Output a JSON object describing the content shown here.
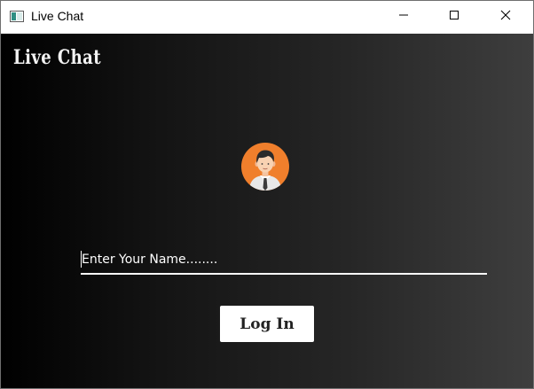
{
  "window": {
    "title": "Live Chat",
    "controls": {
      "minimize": "minimize-icon",
      "maximize": "maximize-icon",
      "close": "close-icon"
    }
  },
  "app": {
    "brand": "Live Chat",
    "avatar": "user-avatar-icon",
    "name_input": {
      "value": "",
      "placeholder": "Enter Your Name........"
    },
    "login_label": "Log In"
  },
  "colors": {
    "avatar_bg": "#f07f2c",
    "background_start": "#000000",
    "background_end": "#3e3e3e",
    "button_bg": "#ffffff",
    "text": "#ffffff"
  }
}
